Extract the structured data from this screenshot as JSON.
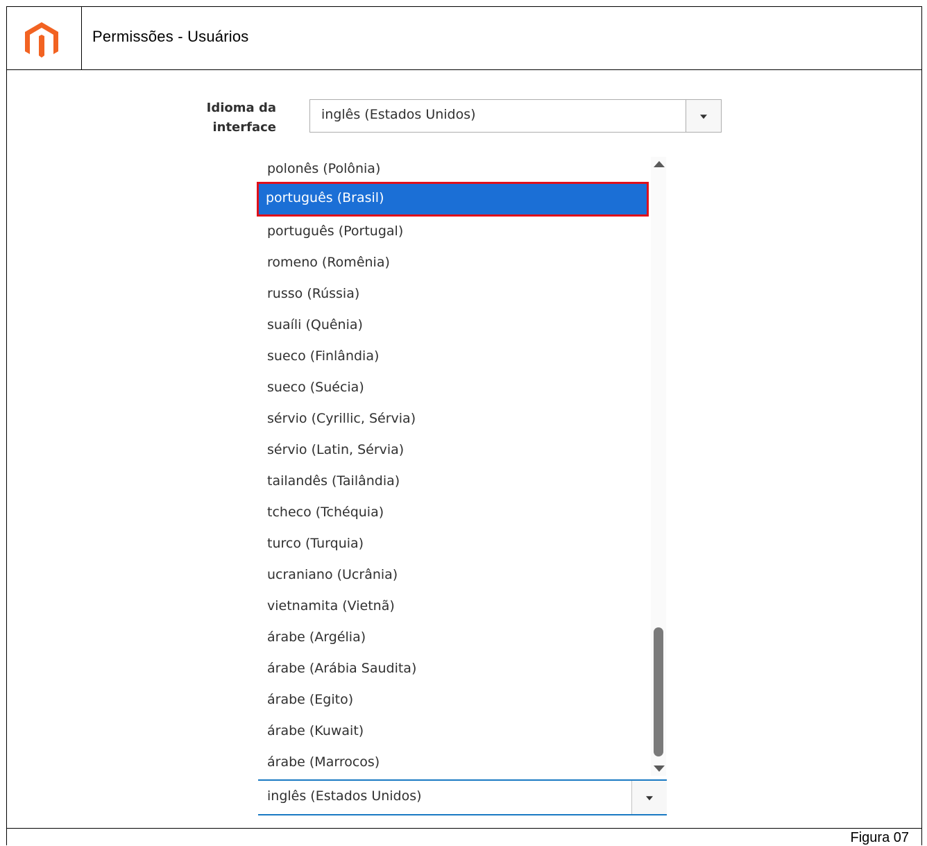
{
  "header": {
    "title": "Permissões - Usuários"
  },
  "logo": {
    "icon": "magento-logo-icon",
    "color": "#f26322"
  },
  "field": {
    "label_line1": "Idioma da",
    "label_line2": "interface",
    "selected_value": "inglês (Estados Unidos)"
  },
  "dropdown": {
    "options": [
      "polonês (Polônia)",
      "português (Brasil)",
      "português (Portugal)",
      "romeno (Romênia)",
      "russo (Rússia)",
      "suaíli (Quênia)",
      "sueco (Finlândia)",
      "sueco (Suécia)",
      "sérvio (Cyrillic, Sérvia)",
      "sérvio (Latin, Sérvia)",
      "tailandês (Tailândia)",
      "tcheco (Tchéquia)",
      "turco (Turquia)",
      "ucraniano (Ucrânia)",
      "vietnamita (Vietnã)",
      "árabe (Argélia)",
      "árabe (Arábia Saudita)",
      "árabe (Egito)",
      "árabe (Kuwait)",
      "árabe (Marrocos)"
    ],
    "highlighted_option": "português (Brasil)",
    "highlight_color": "#1b6fd6",
    "annotation_color": "#e0101a",
    "current_value": "inglês (Estados Unidos)"
  },
  "caption": "Figura 07"
}
